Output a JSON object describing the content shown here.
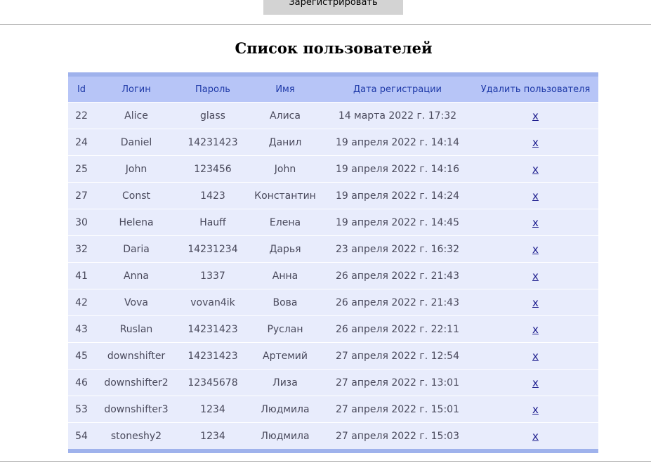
{
  "header": {
    "register_label": "Зарегистрировать"
  },
  "title": "Список пользователей",
  "table": {
    "columns": [
      "Id",
      "Логин",
      "Пароль",
      "Имя",
      "Дата регистрации",
      "Удалить пользователя"
    ],
    "rows": [
      {
        "id": "22",
        "login": "Alice",
        "password": "glass",
        "name": "Алиса",
        "date": "14 марта 2022 г. 17:32",
        "delete": "x"
      },
      {
        "id": "24",
        "login": "Daniel",
        "password": "14231423",
        "name": "Данил",
        "date": "19 апреля 2022 г. 14:14",
        "delete": "x"
      },
      {
        "id": "25",
        "login": "John",
        "password": "123456",
        "name": "John",
        "date": "19 апреля 2022 г. 14:16",
        "delete": "x"
      },
      {
        "id": "27",
        "login": "Const",
        "password": "1423",
        "name": "Константин",
        "date": "19 апреля 2022 г. 14:24",
        "delete": "x"
      },
      {
        "id": "30",
        "login": "Helena",
        "password": "Hauff",
        "name": "Елена",
        "date": "19 апреля 2022 г. 14:45",
        "delete": "x"
      },
      {
        "id": "32",
        "login": "Daria",
        "password": "14231234",
        "name": "Дарья",
        "date": "23 апреля 2022 г. 16:32",
        "delete": "x"
      },
      {
        "id": "41",
        "login": "Anna",
        "password": "1337",
        "name": "Анна",
        "date": "26 апреля 2022 г. 21:43",
        "delete": "x"
      },
      {
        "id": "42",
        "login": "Vova",
        "password": "vovan4ik",
        "name": "Вова",
        "date": "26 апреля 2022 г. 21:43",
        "delete": "x"
      },
      {
        "id": "43",
        "login": "Ruslan",
        "password": "14231423",
        "name": "Руслан",
        "date": "26 апреля 2022 г. 22:11",
        "delete": "x"
      },
      {
        "id": "45",
        "login": "downshifter",
        "password": "14231423",
        "name": "Артемий",
        "date": "27 апреля 2022 г. 12:54",
        "delete": "x"
      },
      {
        "id": "46",
        "login": "downshifter2",
        "password": "12345678",
        "name": "Лиза",
        "date": "27 апреля 2022 г. 13:01",
        "delete": "x"
      },
      {
        "id": "53",
        "login": "downshifter3",
        "password": "1234",
        "name": "Людмила",
        "date": "27 апреля 2022 г. 15:01",
        "delete": "x"
      },
      {
        "id": "54",
        "login": "stoneshy2",
        "password": "1234",
        "name": "Людмила",
        "date": "27 апреля 2022 г. 15:03",
        "delete": "x"
      }
    ]
  }
}
